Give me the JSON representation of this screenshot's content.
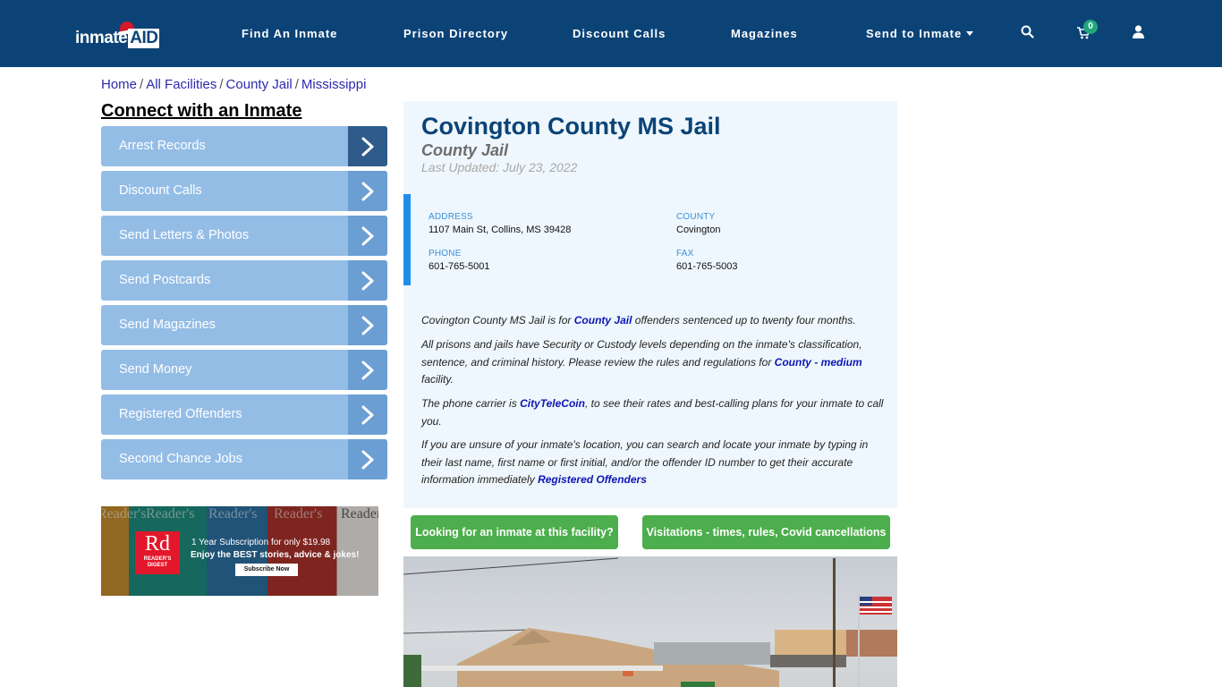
{
  "header": {
    "logo_text": "inmate",
    "logo_accent": "AID",
    "nav": [
      {
        "label": "Find An Inmate"
      },
      {
        "label": "Prison Directory"
      },
      {
        "label": "Discount Calls"
      },
      {
        "label": "Magazines"
      },
      {
        "label": "Send to Inmate",
        "has_dropdown": true
      }
    ],
    "icons": [
      "search-icon",
      "cart-icon",
      "user-icon"
    ],
    "cart_count": "0",
    "colors": {
      "bar": "#0b4377",
      "badge": "#22a67c"
    }
  },
  "breadcrumb": [
    {
      "label": "Home"
    },
    {
      "label": "All Facilities"
    },
    {
      "label": "County Jail"
    },
    {
      "label": "Mississippi"
    }
  ],
  "breadcrumb_separator": "/",
  "sidebar": {
    "title": "Connect with an Inmate",
    "items": [
      {
        "label": "Arrest Records",
        "active": true
      },
      {
        "label": "Discount Calls"
      },
      {
        "label": "Send Letters & Photos"
      },
      {
        "label": "Send Postcards"
      },
      {
        "label": "Send Magazines"
      },
      {
        "label": "Send Money"
      },
      {
        "label": "Registered Offenders"
      },
      {
        "label": "Second Chance Jobs"
      }
    ]
  },
  "ad": {
    "brand_mark": "Rd",
    "brand_name_1": "READER'S",
    "brand_name_2": "DIGEST",
    "cover_title": "Reader's",
    "line1": "1 Year Subscription for only $19.98",
    "line2": "Enjoy the BEST stories, advice & jokes!",
    "cta": "Subscribe Now"
  },
  "facility": {
    "name": "Covington County MS Jail",
    "type": "County Jail",
    "last_updated": "Last Updated: July 23, 2022",
    "address_label": "ADDRESS",
    "address": "1107 Main St, Collins, MS 39428",
    "county_label": "COUNTY",
    "county": "Covington",
    "phone_label": "PHONE",
    "phone": "601-765-5001",
    "fax_label": "FAX",
    "fax": "601-765-5003"
  },
  "description": {
    "p1_pre": "Covington County MS Jail is for ",
    "p1_link": "County Jail",
    "p1_post": " offenders sentenced up to twenty four months.",
    "p2_pre": "All prisons and jails have Security or Custody levels depending on the inmate's classification, sentence, and criminal history. Please review the rules and regulations for ",
    "p2_link": "County - medium",
    "p2_post": " facility.",
    "p3_pre": "The phone carrier is ",
    "p3_link": "CityTeleCoin",
    "p3_post": ", to see their rates and best-calling plans for your inmate to call you.",
    "p4_pre": "If you are unsure of your inmate's location, you can search and locate your inmate by typing in their last name, first name or first initial, and/or the offender ID number to get their accurate information immediately ",
    "p4_link": "Registered Offenders"
  },
  "buttons": {
    "find_inmate": "Looking for an inmate at this facility?",
    "visitation": "Visitations - times, rules, Covid cancellations"
  }
}
